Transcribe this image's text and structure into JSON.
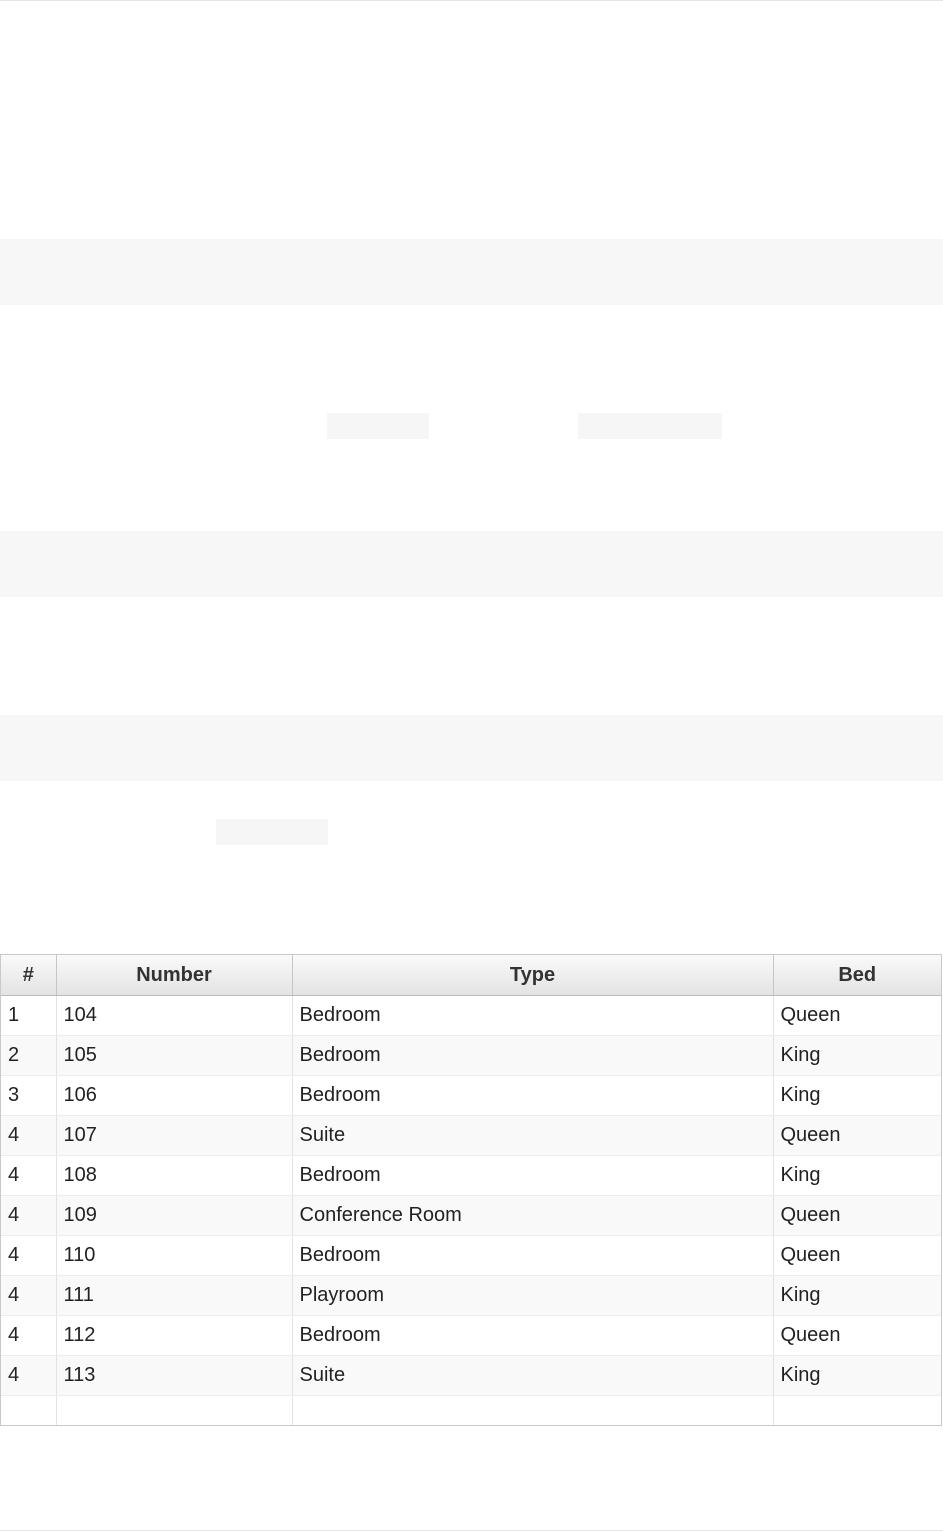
{
  "table": {
    "columns": [
      "#",
      "Number",
      "Type",
      "Bed"
    ],
    "rows": [
      [
        "1",
        "104",
        "Bedroom",
        "Queen"
      ],
      [
        "2",
        "105",
        "Bedroom",
        "King"
      ],
      [
        "3",
        "106",
        "Bedroom",
        "King"
      ],
      [
        "4",
        "107",
        "Suite",
        "Queen"
      ],
      [
        "4",
        "108",
        "Bedroom",
        "King"
      ],
      [
        "4",
        "109",
        "Conference Room",
        "Queen"
      ],
      [
        "4",
        "110",
        "Bedroom",
        "Queen"
      ],
      [
        "4",
        "111",
        "Playroom",
        "King"
      ],
      [
        "4",
        "112",
        "Bedroom",
        "Queen"
      ],
      [
        "4",
        "113",
        "Suite",
        "King"
      ]
    ]
  }
}
